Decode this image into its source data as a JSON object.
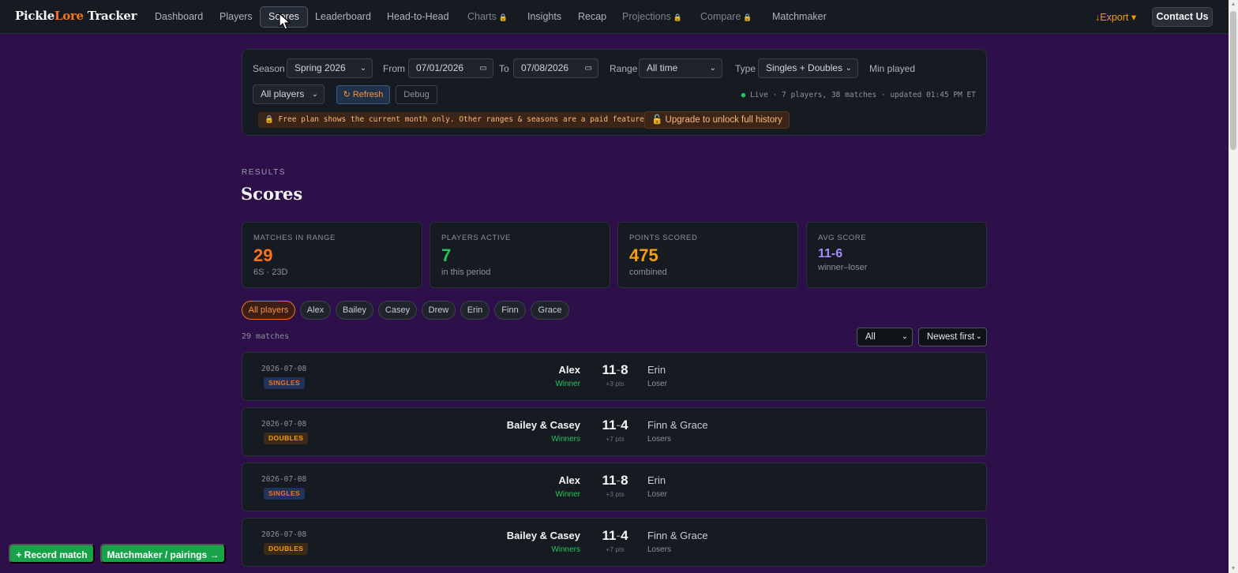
{
  "brand": {
    "part1": "Pickle",
    "part2": "Lore",
    "part3": " Tracker"
  },
  "nav": {
    "dashboard": "Dashboard",
    "players": "Players",
    "scores": "Scores",
    "leaderboard": "Leaderboard",
    "head_to_head": "Head-to-Head",
    "charts": "Charts",
    "insights": "Insights",
    "recap": "Recap",
    "projections": "Projections",
    "compare": "Compare",
    "matchmaker": "Matchmaker",
    "lock_glyph": "🔒",
    "export": "↓Export ▾",
    "contact": "Contact Us"
  },
  "filters": {
    "season_label": "Season",
    "season_value": "Spring 2026",
    "from_label": "From",
    "from_value": "07/01/2026",
    "to_label": "To",
    "to_value": "07/08/2026",
    "range_label": "Range",
    "range_value": "All time",
    "type_label": "Type",
    "type_value": "Singles + Doubles",
    "min_played_label": "Min played",
    "players_value": "All players",
    "refresh_label": "↻ Refresh",
    "debug_label": "Debug",
    "live_dot": "●",
    "live_status": " Live · 7 players, 38 matches · updated 01:45 PM ET",
    "free_plan_notice": "🔒 Free plan shows the current month only. Other ranges & seasons are a paid feature.",
    "upgrade_label": "🔓 Upgrade to unlock full history"
  },
  "results": {
    "eyebrow": "RESULTS",
    "title": "Scores",
    "stats": [
      {
        "label": "MATCHES IN RANGE",
        "value": "29",
        "sub": "6S · 23D",
        "color": "#f97316"
      },
      {
        "label": "PLAYERS ACTIVE",
        "value": "7",
        "sub": "in this period",
        "color": "#22c55e"
      },
      {
        "label": "POINTS SCORED",
        "value": "475",
        "sub": "combined",
        "color": "#f59e0b"
      },
      {
        "label": "AVG SCORE",
        "value": "11-6",
        "sub": "winner–loser",
        "color": "#a78bfa"
      }
    ],
    "player_chips": [
      "All players",
      "Alex",
      "Bailey",
      "Casey",
      "Drew",
      "Erin",
      "Finn",
      "Grace"
    ],
    "match_count": "29 matches",
    "filter_value": "All",
    "sort_value": "Newest first",
    "matches": [
      {
        "date": "2026-07-08",
        "type": "SINGLES",
        "winner": "Alex",
        "winner_tag": "Winner",
        "score_w": "11",
        "score_l": "8",
        "diff": "+3 pts",
        "loser": "Erin",
        "loser_tag": "Loser"
      },
      {
        "date": "2026-07-08",
        "type": "DOUBLES",
        "winner": "Bailey & Casey",
        "winner_tag": "Winners",
        "score_w": "11",
        "score_l": "4",
        "diff": "+7 pts",
        "loser": "Finn & Grace",
        "loser_tag": "Losers"
      },
      {
        "date": "2026-07-08",
        "type": "SINGLES",
        "winner": "Alex",
        "winner_tag": "Winner",
        "score_w": "11",
        "score_l": "8",
        "diff": "+3 pts",
        "loser": "Erin",
        "loser_tag": "Loser"
      },
      {
        "date": "2026-07-08",
        "type": "DOUBLES",
        "winner": "Bailey & Casey",
        "winner_tag": "Winners",
        "score_w": "11",
        "score_l": "4",
        "diff": "+7 pts",
        "loser": "Finn & Grace",
        "loser_tag": "Losers"
      }
    ]
  },
  "fab": {
    "record_match": "+ Record match",
    "matchmaker": "Matchmaker / pairings →"
  },
  "icons": {
    "select_chevron": "⌄",
    "calendar": "▭",
    "cursor": "arrow-cursor-icon"
  }
}
